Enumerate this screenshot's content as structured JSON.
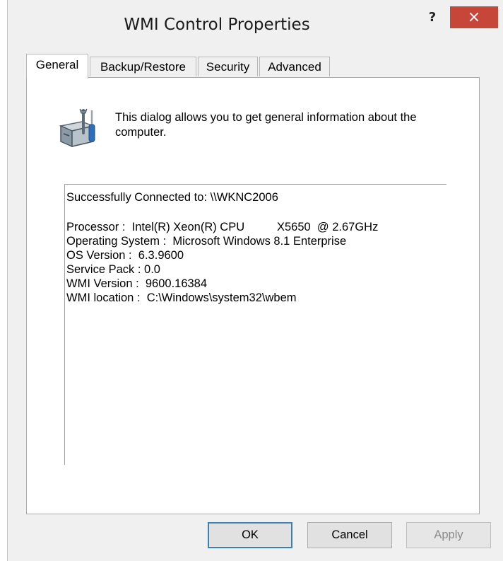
{
  "window": {
    "title": "WMI Control Properties",
    "help_label": "?",
    "close_label": "×",
    "close_color": "#c7463a"
  },
  "tabs": [
    {
      "label": "General",
      "active": true
    },
    {
      "label": "Backup/Restore",
      "active": false
    },
    {
      "label": "Security",
      "active": false
    },
    {
      "label": "Advanced",
      "active": false
    }
  ],
  "general": {
    "icon": "tools-icon",
    "description": "This dialog allows you to get general information about the computer.",
    "info_lines": [
      "Successfully Connected to: \\\\WKNC2006",
      "Processor :  Intel(R) Xeon(R) CPU          X5650  @ 2.67GHz",
      "Operating System :  Microsoft Windows 8.1 Enterprise",
      "OS Version :  6.3.9600",
      "Service Pack : 0.0",
      "WMI Version :  9600.16384",
      "WMI location :  C:\\Windows\\system32\\wbem"
    ]
  },
  "buttons": {
    "ok": "OK",
    "cancel": "Cancel",
    "apply": "Apply"
  }
}
